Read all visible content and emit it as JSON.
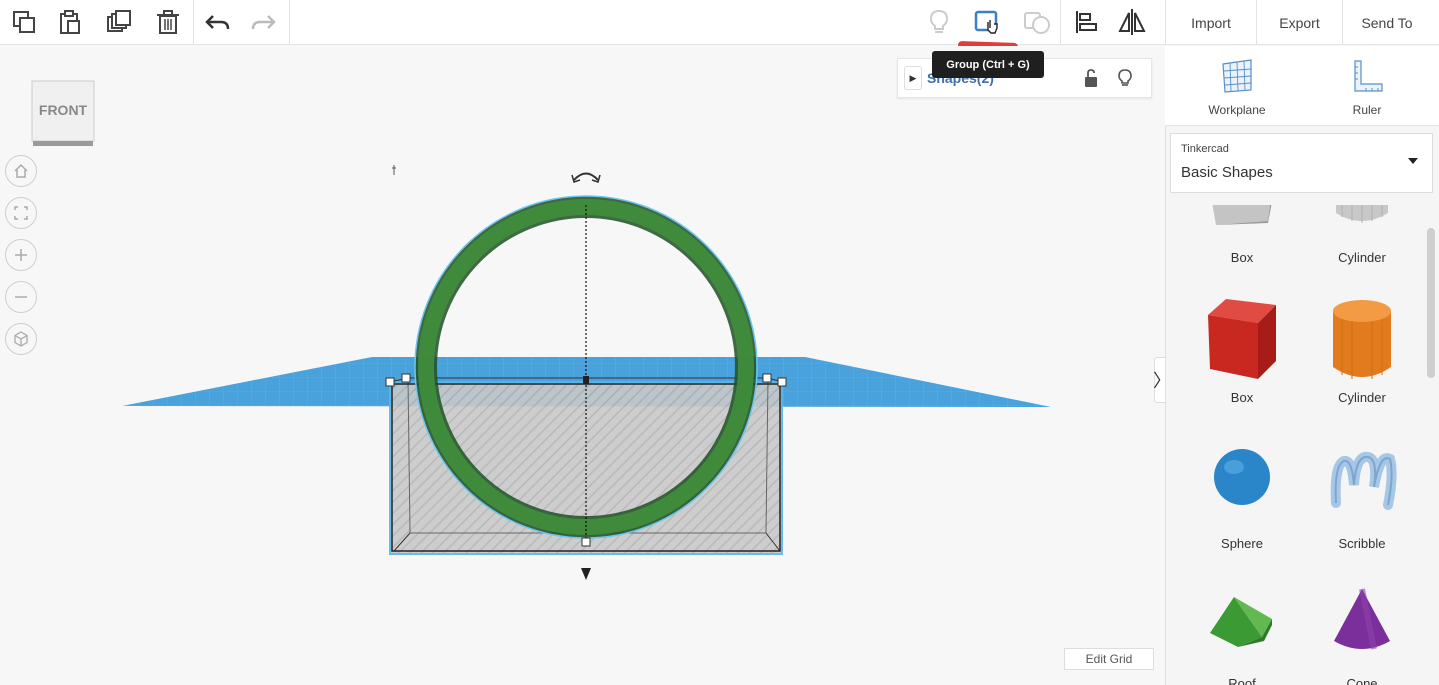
{
  "toolbar": {
    "import_label": "Import",
    "export_label": "Export",
    "send_to_label": "Send To"
  },
  "tooltip": {
    "text": "Group (Ctrl + G)"
  },
  "viewcube": {
    "label": "FRONT"
  },
  "shapes_panel": {
    "title": "Shapes(2)"
  },
  "canvas": {
    "edit_grid_label": "Edit Grid"
  },
  "sidebar": {
    "workplane_label": "Workplane",
    "ruler_label": "Ruler",
    "library_source": "Tinkercad",
    "library_value": "Basic Shapes",
    "shapes": [
      {
        "label": "Box"
      },
      {
        "label": "Cylinder"
      },
      {
        "label": "Box"
      },
      {
        "label": "Cylinder"
      },
      {
        "label": "Sphere"
      },
      {
        "label": "Scribble"
      },
      {
        "label": "Roof"
      },
      {
        "label": "Cone"
      }
    ]
  },
  "colors": {
    "accent": "#3b6fb0",
    "workplane": "#4a9fd8",
    "torus": "#3d8a3a",
    "annotation": "#e23b3b"
  }
}
